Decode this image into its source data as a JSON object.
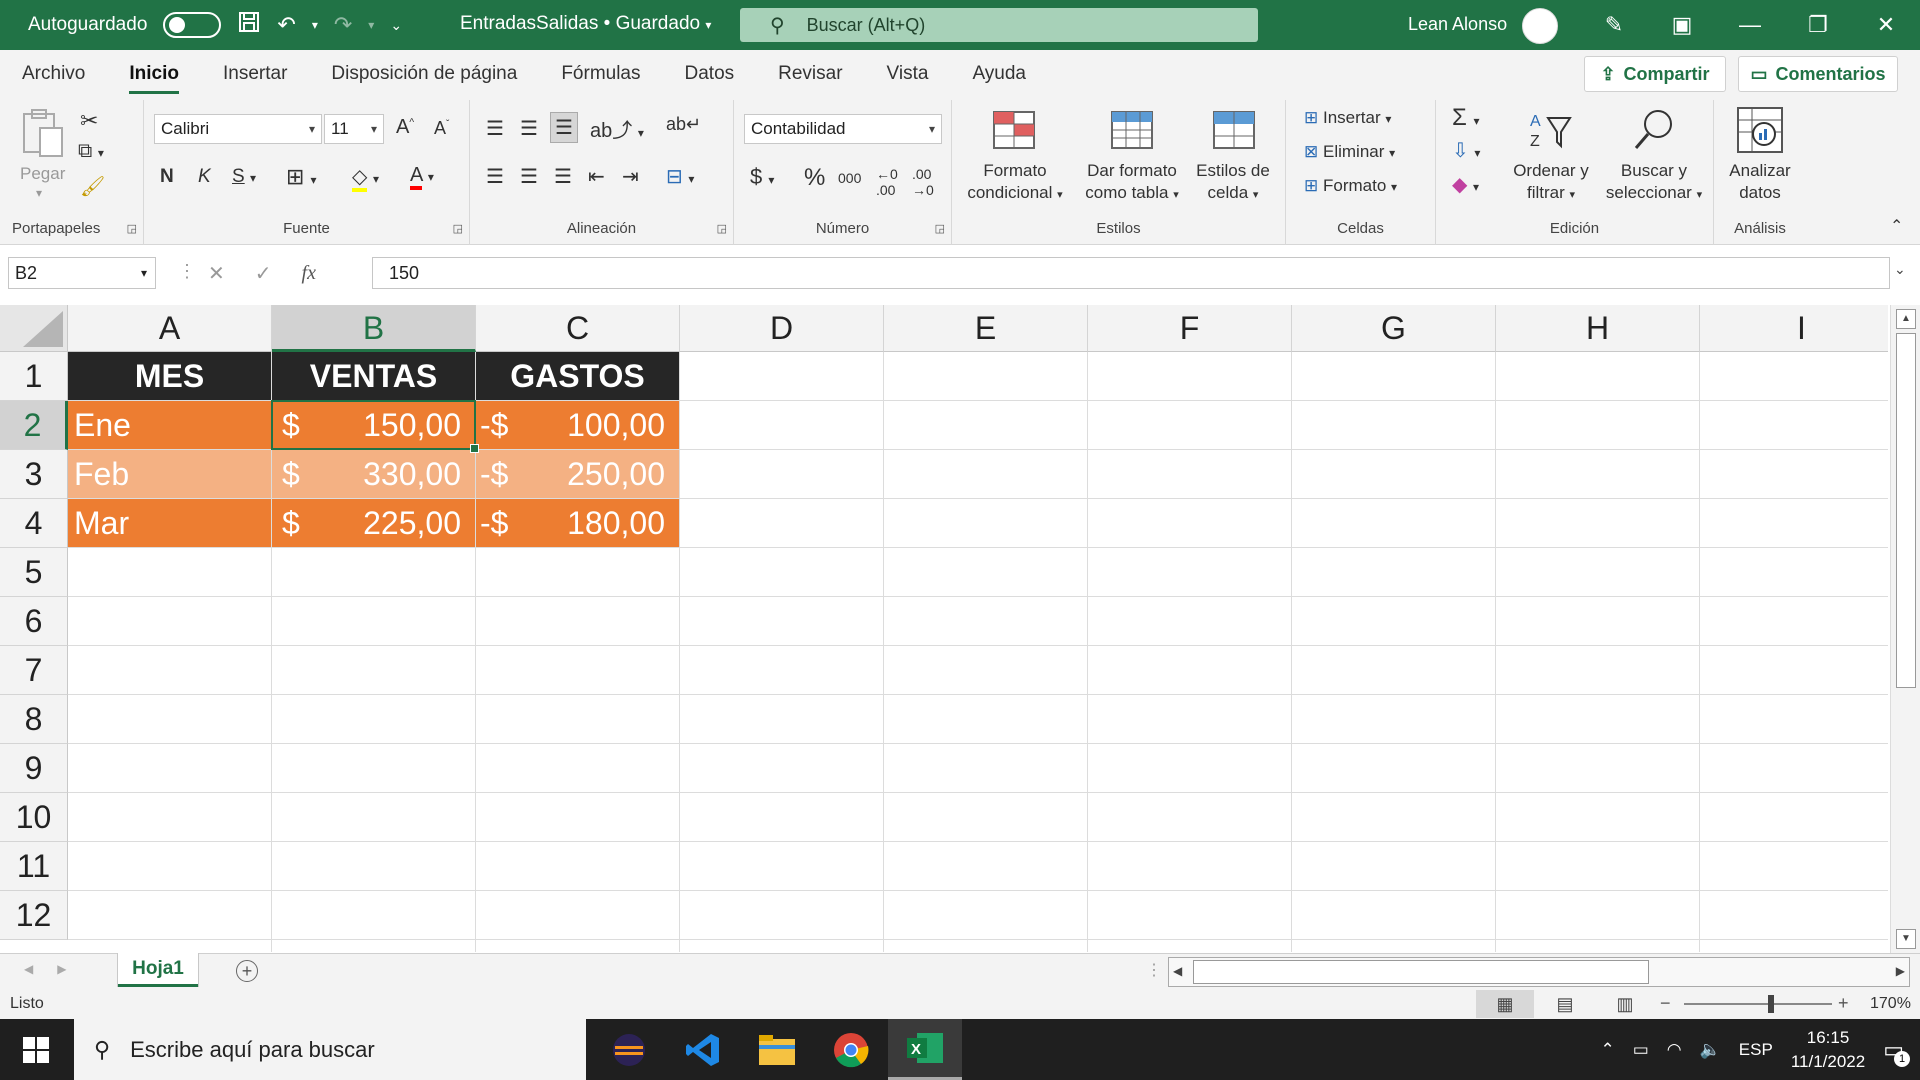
{
  "titlebar": {
    "autosave_label": "Autoguardado",
    "doc_title": "EntradasSalidas • Guardado",
    "search_placeholder": "Buscar (Alt+Q)",
    "user_name": "Lean Alonso"
  },
  "menu": {
    "tabs": [
      "Archivo",
      "Inicio",
      "Insertar",
      "Disposición de página",
      "Fórmulas",
      "Datos",
      "Revisar",
      "Vista",
      "Ayuda"
    ],
    "active_tab": "Inicio",
    "share_label": "Compartir",
    "comments_label": "Comentarios"
  },
  "ribbon": {
    "portapapeles": {
      "label": "Portapapeles",
      "paste": "Pegar"
    },
    "fuente": {
      "label": "Fuente",
      "font_name": "Calibri",
      "font_size": "11",
      "bold": "N",
      "italic": "K",
      "underline": "S"
    },
    "alineacion": {
      "label": "Alineación"
    },
    "numero": {
      "label": "Número",
      "format": "Contabilidad",
      "currency": "$",
      "percent": "%",
      "thousands": "000"
    },
    "estilos": {
      "label": "Estilos",
      "cond_format_1": "Formato",
      "cond_format_2": "condicional",
      "table_format_1": "Dar formato",
      "table_format_2": "como tabla",
      "cell_styles_1": "Estilos de",
      "cell_styles_2": "celda"
    },
    "celdas": {
      "label": "Celdas",
      "insert": "Insertar",
      "delete": "Eliminar",
      "format": "Formato"
    },
    "edicion": {
      "label": "Edición",
      "sort_1": "Ordenar y",
      "sort_2": "filtrar",
      "find_1": "Buscar y",
      "find_2": "seleccionar"
    },
    "analisis": {
      "label": "Análisis",
      "analyze_1": "Analizar",
      "analyze_2": "datos"
    }
  },
  "formula_bar": {
    "name_box": "B2",
    "fx": "fx",
    "value": "150"
  },
  "sheet": {
    "columns": [
      "A",
      "B",
      "C",
      "D",
      "E",
      "F",
      "G",
      "H",
      "I"
    ],
    "selected_column": "B",
    "rows": [
      "1",
      "2",
      "3",
      "4",
      "5",
      "6",
      "7",
      "8",
      "9",
      "10",
      "11",
      "12"
    ],
    "selected_row": "2",
    "headers": [
      "MES",
      "VENTAS",
      "GASTOS"
    ],
    "data": [
      {
        "mes": "Ene",
        "ventas_cur": "$",
        "ventas": "150,00",
        "gastos_cur": "-$",
        "gastos": "100,00"
      },
      {
        "mes": "Feb",
        "ventas_cur": "$",
        "ventas": "330,00",
        "gastos_cur": "-$",
        "gastos": "250,00"
      },
      {
        "mes": "Mar",
        "ventas_cur": "$",
        "ventas": "225,00",
        "gastos_cur": "-$",
        "gastos": "180,00"
      }
    ],
    "tab_name": "Hoja1"
  },
  "status": {
    "text": "Listo",
    "zoom": "170%"
  },
  "taskbar": {
    "search_placeholder": "Escribe aquí para buscar",
    "lang": "ESP",
    "time": "16:15",
    "date": "11/1/2022",
    "notif_count": "1"
  },
  "colors": {
    "excel_green": "#217346",
    "header_dark": "#262626",
    "row_orange": "#ed7d31",
    "row_light_orange": "#f4b183"
  }
}
